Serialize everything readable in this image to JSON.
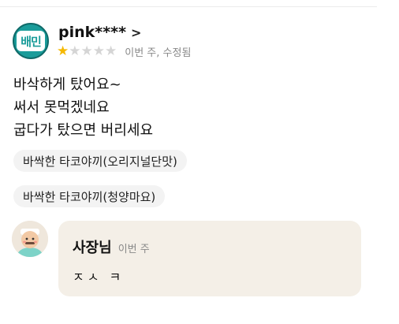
{
  "review": {
    "logo_text": "배민",
    "nickname": "pink****",
    "chevron": "›",
    "rating": 1,
    "rating_max": 5,
    "time": "이번 주, 수정됨",
    "lines": [
      "바삭하게 탔어요~",
      "써서 못먹겠네요",
      "굽다가 탔으면 버리세요"
    ],
    "menu_tags": [
      "바싹한 타코야끼(오리지널단맛)",
      "바싹한 타코야끼(청양마요)"
    ]
  },
  "reply": {
    "owner_name": "사장님",
    "time": "이번 주",
    "body": "ㅈㅅ ㅋ"
  },
  "colors": {
    "star_on": "#f5b800",
    "star_off": "#d5d5d5",
    "chip_bg": "#f3f3f3",
    "reply_bg": "#f4efe7",
    "logo": "#1a9c9a"
  }
}
